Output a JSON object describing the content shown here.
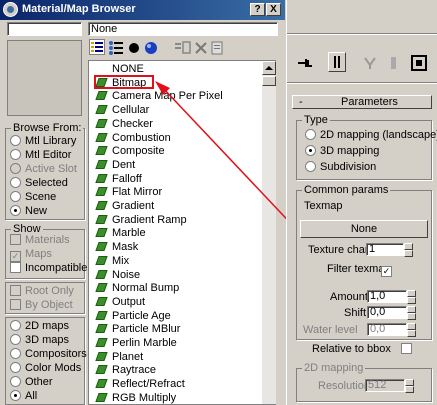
{
  "window": {
    "title": "Material/Map Browser",
    "help_label": "?",
    "close_label": "X"
  },
  "name_field": {
    "value": "None"
  },
  "browse_from": {
    "title": "Browse From:",
    "options": [
      {
        "label": "Mtl Library",
        "selected": false,
        "enabled": true
      },
      {
        "label": "Mtl Editor",
        "selected": false,
        "enabled": true
      },
      {
        "label": "Active Slot",
        "selected": false,
        "enabled": false
      },
      {
        "label": "Selected",
        "selected": false,
        "enabled": true
      },
      {
        "label": "Scene",
        "selected": false,
        "enabled": true
      },
      {
        "label": "New",
        "selected": true,
        "enabled": true
      }
    ]
  },
  "show": {
    "title": "Show",
    "checks": [
      {
        "label": "Materials",
        "checked": false,
        "enabled": false
      },
      {
        "label": "Maps",
        "checked": true,
        "enabled": false
      },
      {
        "label": "Incompatible",
        "checked": false,
        "enabled": true
      }
    ],
    "checks2": [
      {
        "label": "Root Only",
        "checked": false,
        "enabled": false
      },
      {
        "label": "By Object",
        "checked": false,
        "enabled": false
      }
    ]
  },
  "map_type_filter": [
    {
      "label": "2D maps",
      "selected": false
    },
    {
      "label": "3D maps",
      "selected": false
    },
    {
      "label": "Compositors",
      "selected": false
    },
    {
      "label": "Color Mods",
      "selected": false
    },
    {
      "label": "Other",
      "selected": false
    },
    {
      "label": "All",
      "selected": true
    }
  ],
  "map_list": [
    "NONE",
    "Bitmap",
    "Camera Map Per Pixel",
    "Cellular",
    "Checker",
    "Combustion",
    "Composite",
    "Dent",
    "Falloff",
    "Flat Mirror",
    "Gradient",
    "Gradient Ramp",
    "Marble",
    "Mask",
    "Mix",
    "Noise",
    "Normal Bump",
    "Output",
    "Particle Age",
    "Particle MBlur",
    "Perlin Marble",
    "Planet",
    "Raytrace",
    "Reflect/Refract",
    "RGB Multiply"
  ],
  "parameters": {
    "rollout_title": "Parameters",
    "rollout_toggle": "-",
    "type_group": "Type",
    "type_options": [
      {
        "label": "2D mapping (landscape)",
        "selected": false
      },
      {
        "label": "3D mapping",
        "selected": true
      },
      {
        "label": "Subdivision",
        "selected": false
      }
    ],
    "common_group": "Common params",
    "texmap_label": "Texmap",
    "texmap_button": "None",
    "texture_chan_label": "Texture chan",
    "texture_chan_value": "1",
    "filter_texmap_label": "Filter texmap",
    "filter_texmap_checked": true,
    "amount_label": "Amount",
    "amount_value": "1,0",
    "shift_label": "Shift",
    "shift_value": "0,0",
    "water_level_label": "Water level",
    "water_level_value": "0,0",
    "relative_label": "Relative to bbox",
    "subdiv_group": "2D mapping",
    "resolution_label": "Resolution",
    "resolution_value": "512"
  },
  "colors": {
    "highlight_red": "#e0101a",
    "title_blue": "#0a246a",
    "panel_gray": "#d4d0c8"
  }
}
